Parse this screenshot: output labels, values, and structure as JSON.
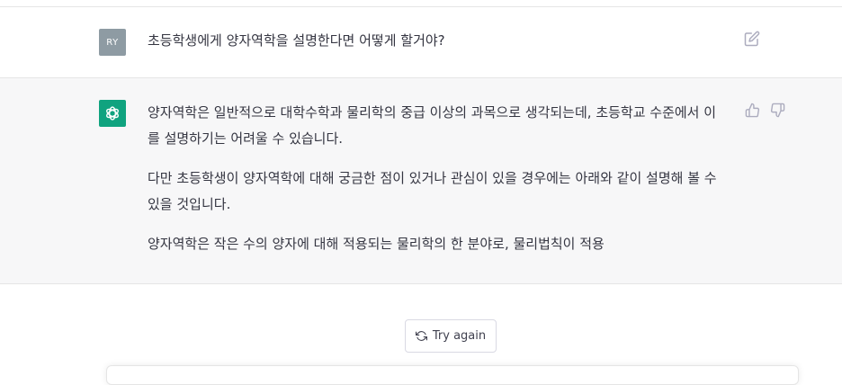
{
  "user_message": {
    "avatar_initials": "RY",
    "text": "초등학생에게 양자역학을 설명한다면 어떻게 할거야?"
  },
  "assistant_message": {
    "paragraphs": [
      "양자역학은 일반적으로 대학수학과 물리학의 중급 이상의 과목으로 생각되는데, 초등학교 수준에서 이를 설명하기는 어려울 수 있습니다.",
      "다만 초등학생이 양자역학에 대해 궁금한 점이 있거나 관심이 있을 경우에는 아래와 같이 설명해 볼 수 있을 것입니다.",
      "양자역학은 작은 수의 양자에 대해 적용되는 물리학의 한 분야로, 물리법칙이 적용"
    ]
  },
  "actions": {
    "try_again_label": "Try again"
  },
  "icons": {
    "edit": "edit-icon",
    "thumbs_up": "thumbs-up-icon",
    "thumbs_down": "thumbs-down-icon",
    "refresh": "refresh-icon",
    "bot_logo": "openai-logo-icon"
  },
  "colors": {
    "user_avatar": "#8e9ba3",
    "bot_avatar": "#10a37f",
    "assistant_bg": "#f7f7f8"
  }
}
